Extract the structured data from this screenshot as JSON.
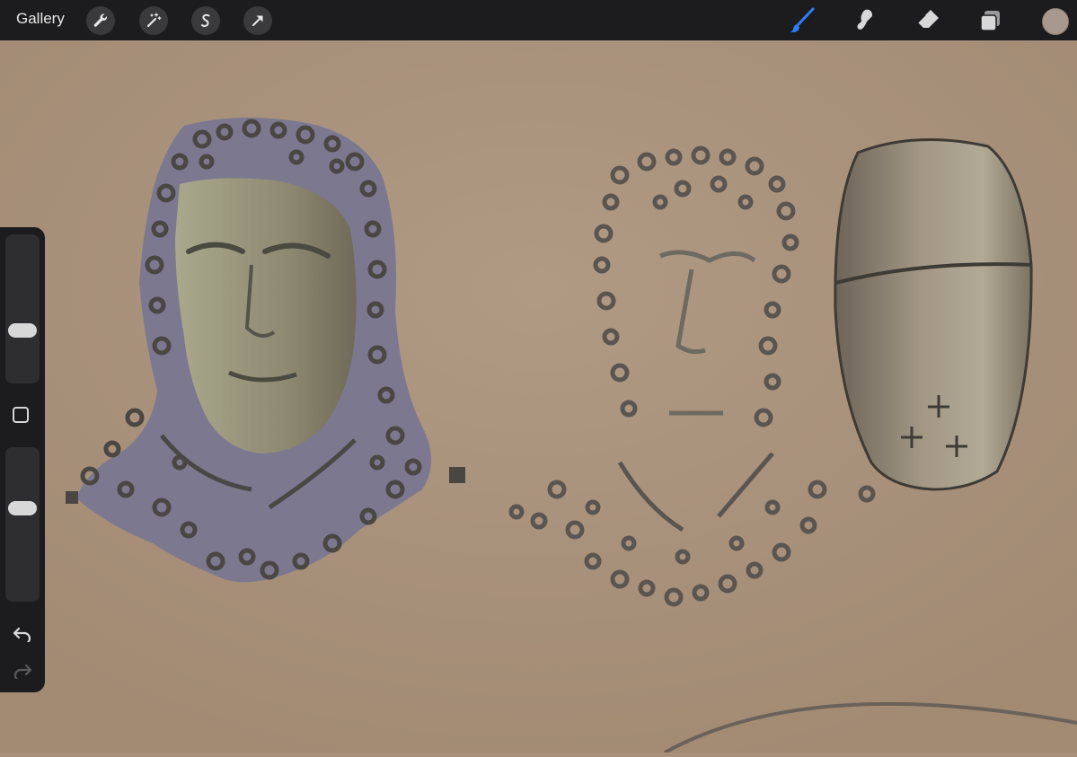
{
  "topbar": {
    "gallery_label": "Gallery",
    "left_tools": [
      "wrench-icon",
      "magic-wand-icon",
      "selection-icon",
      "transform-arrow-icon"
    ],
    "right_tools": [
      "brush-icon",
      "smudge-icon",
      "eraser-icon",
      "layers-icon"
    ],
    "active_tool": "brush-icon",
    "active_color": "#a8998e",
    "accent_color": "#2f7cf6"
  },
  "sidebar": {
    "brush_size_level": 0.33,
    "opacity_level": 0.62,
    "items": [
      "brush-size-slider",
      "modify-button",
      "opacity-slider",
      "undo-button",
      "redo-button"
    ]
  },
  "canvas": {
    "background_color": "#a8907a",
    "drawings": [
      "chainmail-face-sketch",
      "chainmail-outline-sketch",
      "great-helm-sketch"
    ]
  }
}
